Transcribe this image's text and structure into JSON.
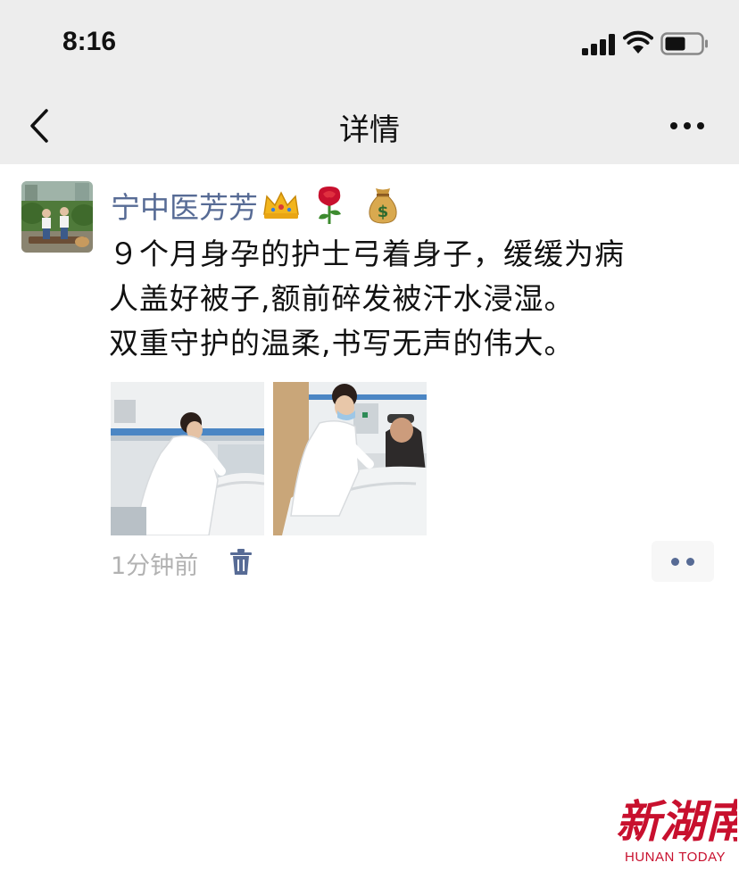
{
  "status": {
    "time": "8:16"
  },
  "nav": {
    "title": "详情"
  },
  "post": {
    "author": "宁中医芳芳",
    "emojis": [
      "crown-icon",
      "rose-icon",
      "money-bag-icon"
    ],
    "text_lines": [
      "９个月身孕的护士弓着身子，缓缓为病",
      "人盖好被子,额前碎发被汗水浸湿。",
      "双重守护的温柔,书写无声的伟大。"
    ],
    "photos": [
      "nurse-covering-patient-photo",
      "nurse-tending-elderly-patient-photo"
    ],
    "time": "1分钟前"
  },
  "watermark": {
    "logo": "新湖南",
    "text": "HUNAN TODAY"
  },
  "colors": {
    "bar_bg": "#ededed",
    "link_blue": "#576b95",
    "meta_gray": "#b2b2b2",
    "brand_red": "#c8102e"
  }
}
